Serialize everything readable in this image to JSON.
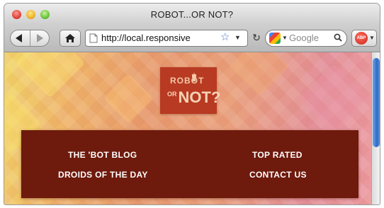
{
  "window": {
    "title": "ROBOT...OR NOT?"
  },
  "toolbar": {
    "url": "http://local.responsive",
    "search_placeholder": "Google",
    "addon_label": "ABP"
  },
  "site": {
    "logo": {
      "line1": "ROBOT",
      "or": "OR",
      "line2": "NOT?"
    },
    "nav": [
      {
        "label": "THE 'BOT BLOG"
      },
      {
        "label": "TOP RATED"
      },
      {
        "label": "DROIDS OF THE DAY"
      },
      {
        "label": "CONTACT US"
      }
    ]
  },
  "colors": {
    "logo_box": "#b83a22",
    "nav_panel": "#6e1a0c",
    "page_background": [
      "#f2d86a",
      "#efb56a",
      "#e79a6e",
      "#e3909a"
    ]
  },
  "icons": [
    "close-traffic-light",
    "minimize-traffic-light",
    "zoom-traffic-light",
    "back-arrow-icon",
    "forward-arrow-icon",
    "home-icon",
    "page-icon",
    "star-icon",
    "chevron-down-icon",
    "reload-icon",
    "google-icon",
    "search-icon",
    "adblock-icon",
    "robot-icon"
  ]
}
